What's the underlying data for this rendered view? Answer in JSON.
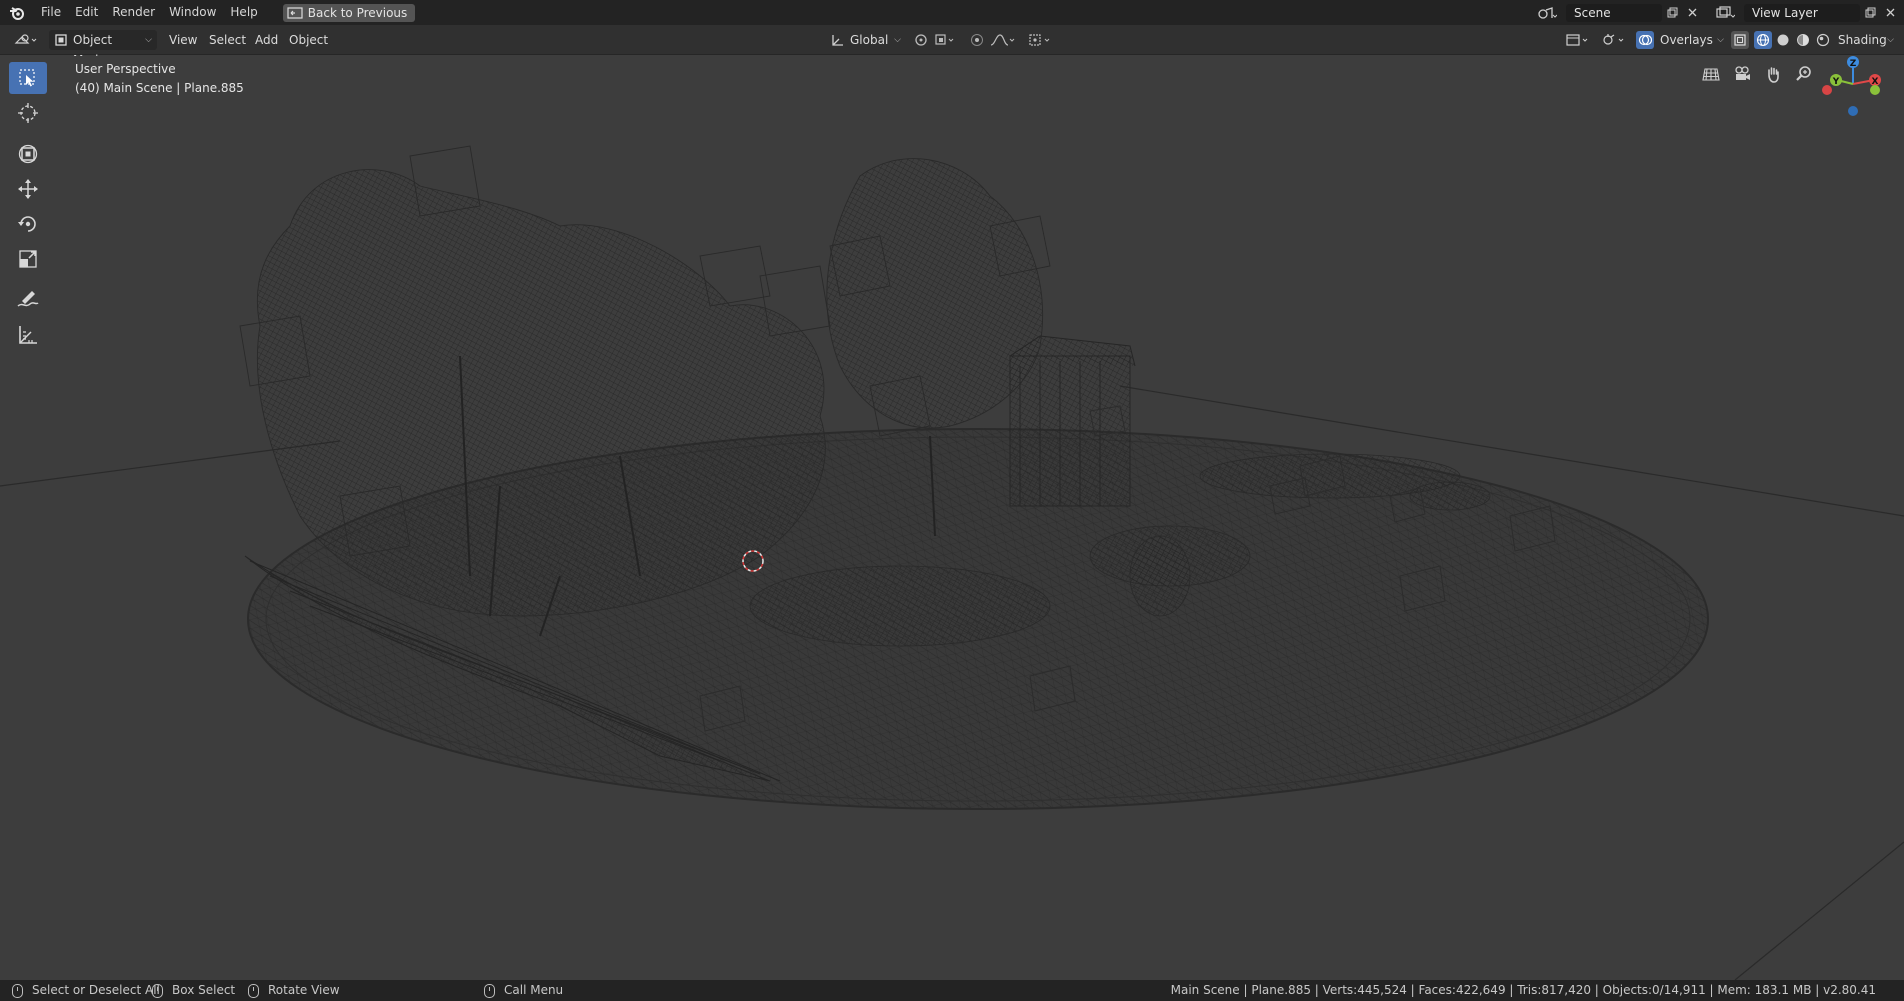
{
  "menubar": {
    "items": [
      "File",
      "Edit",
      "Render",
      "Window",
      "Help"
    ],
    "back_button": "Back to Previous",
    "scene_field": "Scene",
    "view_layer_field": "View Layer"
  },
  "header": {
    "mode": "Object Mode",
    "menus": [
      "View",
      "Select",
      "Add",
      "Object"
    ],
    "transform_orientation": "Global",
    "overlays_label": "Overlays",
    "shading_label": "Shading"
  },
  "viewport": {
    "perspective_label": "User Perspective",
    "scene_object_label": "(40) Main Scene | Plane.885",
    "gizmo_axes": [
      "X",
      "Y",
      "Z"
    ]
  },
  "toolbar": {
    "tools": [
      "select-box-icon",
      "cursor-icon",
      "transform-icon",
      "move-icon",
      "rotate-icon",
      "scale-icon",
      "annotate-icon",
      "measure-icon"
    ]
  },
  "statusbar": {
    "hint_select": "Select or Deselect All",
    "hint_box": "Box Select",
    "hint_rotate": "Rotate View",
    "hint_menu": "Call Menu",
    "stats": "Main Scene | Plane.885 | Verts:445,524 | Faces:422,649 | Tris:817,420 | Objects:0/14,911 | Mem: 183.1 MB | v2.80.41"
  },
  "colors": {
    "accent": "#4772b3",
    "axis_x": "#e04848",
    "axis_y": "#8ac13a",
    "axis_z": "#3d8ce0"
  }
}
